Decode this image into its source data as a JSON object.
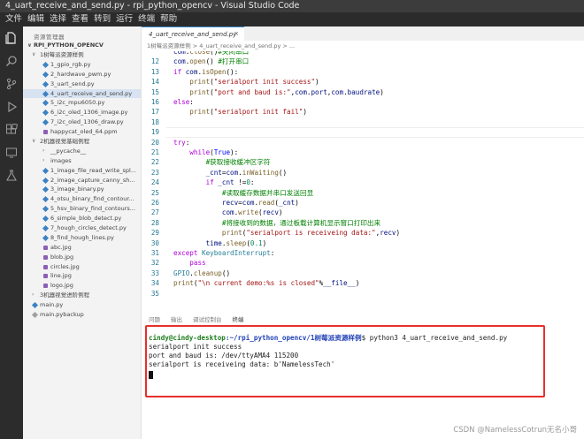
{
  "window": {
    "title": "4_uart_receive_and_send.py - rpi_python_opencv - Visual Studio Code"
  },
  "menu": [
    "文件",
    "编辑",
    "选择",
    "查看",
    "转到",
    "运行",
    "终端",
    "帮助"
  ],
  "activity_icons": [
    "explorer-icon",
    "search-icon",
    "source-control-icon",
    "run-debug-icon",
    "extensions-icon",
    "remote-icon",
    "test-icon"
  ],
  "sidebar": {
    "title": "资源管理器",
    "root": "RPI_PYTHON_OPENCV",
    "items": [
      {
        "label": "1树莓派资源样例",
        "kind": "folder-open",
        "depth": 0
      },
      {
        "label": "1_gpio_rgb.py",
        "kind": "py",
        "depth": 1
      },
      {
        "label": "2_hardwave_pwm.py",
        "kind": "py",
        "depth": 1
      },
      {
        "label": "3_uart_send.py",
        "kind": "py",
        "depth": 1
      },
      {
        "label": "4_uart_receive_and_send.py",
        "kind": "py",
        "depth": 1,
        "selected": true
      },
      {
        "label": "5_i2c_mpu6050.py",
        "kind": "py",
        "depth": 1
      },
      {
        "label": "6_i2c_oled_1306_image.py",
        "kind": "py",
        "depth": 1
      },
      {
        "label": "7_i2c_oled_1306_draw.py",
        "kind": "py",
        "depth": 1
      },
      {
        "label": "happycat_oled_64.ppm",
        "kind": "img",
        "depth": 1
      },
      {
        "label": "2机器视觉基础例程",
        "kind": "folder-open",
        "depth": 0
      },
      {
        "label": "__pycache__",
        "kind": "folder",
        "depth": 1
      },
      {
        "label": "images",
        "kind": "folder",
        "depth": 1
      },
      {
        "label": "1_image_file_read_write_spl...",
        "kind": "py",
        "depth": 1
      },
      {
        "label": "2_image_capture_canny_sh...",
        "kind": "py",
        "depth": 1
      },
      {
        "label": "3_image_binary.py",
        "kind": "py",
        "depth": 1
      },
      {
        "label": "4_otsu_binary_find_contour...",
        "kind": "py",
        "depth": 1
      },
      {
        "label": "5_hsv_binary_find_contours...",
        "kind": "py",
        "depth": 1
      },
      {
        "label": "6_simple_blob_detect.py",
        "kind": "py",
        "depth": 1
      },
      {
        "label": "7_hough_circles_detect.py",
        "kind": "py",
        "depth": 1
      },
      {
        "label": "8_find_hough_lines.py",
        "kind": "py",
        "depth": 1
      },
      {
        "label": "abc.jpg",
        "kind": "img",
        "depth": 1
      },
      {
        "label": "blob.jpg",
        "kind": "img",
        "depth": 1
      },
      {
        "label": "circles.jpg",
        "kind": "img",
        "depth": 1
      },
      {
        "label": "line.jpg",
        "kind": "img",
        "depth": 1
      },
      {
        "label": "logo.jpg",
        "kind": "img",
        "depth": 1
      },
      {
        "label": "3机器视觉进阶例程",
        "kind": "folder",
        "depth": 0
      },
      {
        "label": "main.py",
        "kind": "py",
        "depth": 0
      },
      {
        "label": "main.pybackup",
        "kind": "bak",
        "depth": 0
      }
    ]
  },
  "editor": {
    "tab": {
      "label": "4_uart_receive_and_send.py",
      "close": "×"
    },
    "breadcrumb": "1树莓派资源样例 > 4_uart_receive_and_send.py > ...",
    "lines": [
      {
        "n": "",
        "src": [
          [
            "v",
            "com"
          ],
          [
            "d",
            "."
          ],
          [
            "f",
            "close"
          ],
          [
            "d",
            "()"
          ],
          [
            "c",
            "#关闭串口"
          ]
        ],
        "clip": true
      },
      {
        "n": "12",
        "src": [
          [
            "v",
            "com"
          ],
          [
            "d",
            "."
          ],
          [
            "f",
            "open"
          ],
          [
            "d",
            "() "
          ],
          [
            "c",
            "#打开串口"
          ]
        ]
      },
      {
        "n": "13",
        "src": [
          [
            "k",
            "if "
          ],
          [
            "v",
            "com"
          ],
          [
            "d",
            "."
          ],
          [
            "f",
            "isOpen"
          ],
          [
            "d",
            "():"
          ]
        ]
      },
      {
        "n": "14",
        "src": [
          [
            "d",
            "    "
          ],
          [
            "f",
            "print"
          ],
          [
            "d",
            "("
          ],
          [
            "s",
            "\"serialport init success\""
          ],
          [
            "d",
            ")"
          ]
        ]
      },
      {
        "n": "15",
        "src": [
          [
            "d",
            "    "
          ],
          [
            "f",
            "print"
          ],
          [
            "d",
            "("
          ],
          [
            "s",
            "\"port and baud is:\""
          ],
          [
            "d",
            ","
          ],
          [
            "v",
            "com"
          ],
          [
            "d",
            "."
          ],
          [
            "v",
            "port"
          ],
          [
            "d",
            ","
          ],
          [
            "v",
            "com"
          ],
          [
            "d",
            "."
          ],
          [
            "v",
            "baudrate"
          ],
          [
            "d",
            ")"
          ]
        ]
      },
      {
        "n": "16",
        "src": [
          [
            "k",
            "else"
          ],
          [
            "d",
            ":"
          ]
        ]
      },
      {
        "n": "17",
        "src": [
          [
            "d",
            "    "
          ],
          [
            "f",
            "print"
          ],
          [
            "d",
            "("
          ],
          [
            "s",
            "\"serialport init fail\""
          ],
          [
            "d",
            ")"
          ]
        ]
      },
      {
        "n": "18",
        "src": []
      },
      {
        "n": "19",
        "src": [],
        "current": true
      },
      {
        "n": "20",
        "src": [
          [
            "k",
            "try"
          ],
          [
            "d",
            ":"
          ]
        ]
      },
      {
        "n": "21",
        "src": [
          [
            "d",
            "    "
          ],
          [
            "k",
            "while"
          ],
          [
            "d",
            "("
          ],
          [
            "kb",
            "True"
          ],
          [
            "d",
            "):"
          ]
        ]
      },
      {
        "n": "22",
        "src": [
          [
            "d",
            "        "
          ],
          [
            "c",
            "#获取接收缓冲区字符"
          ]
        ]
      },
      {
        "n": "23",
        "src": [
          [
            "d",
            "        "
          ],
          [
            "v",
            "_cnt"
          ],
          [
            "d",
            "="
          ],
          [
            "v",
            "com"
          ],
          [
            "d",
            "."
          ],
          [
            "f",
            "inWaiting"
          ],
          [
            "d",
            "()"
          ]
        ]
      },
      {
        "n": "24",
        "src": [
          [
            "d",
            "        "
          ],
          [
            "k",
            "if "
          ],
          [
            "v",
            "_cnt"
          ],
          [
            "d",
            " !="
          ],
          [
            "n",
            "0"
          ],
          [
            "d",
            ":"
          ]
        ]
      },
      {
        "n": "25",
        "src": [
          [
            "d",
            "            "
          ],
          [
            "c",
            "#读取缓存数据并串口发送回显"
          ]
        ]
      },
      {
        "n": "26",
        "src": [
          [
            "d",
            "            "
          ],
          [
            "v",
            "recv"
          ],
          [
            "d",
            "="
          ],
          [
            "v",
            "com"
          ],
          [
            "d",
            "."
          ],
          [
            "f",
            "read"
          ],
          [
            "d",
            "("
          ],
          [
            "v",
            "_cnt"
          ],
          [
            "d",
            ")"
          ]
        ]
      },
      {
        "n": "27",
        "src": [
          [
            "d",
            "            "
          ],
          [
            "v",
            "com"
          ],
          [
            "d",
            "."
          ],
          [
            "f",
            "write"
          ],
          [
            "d",
            "("
          ],
          [
            "v",
            "recv"
          ],
          [
            "d",
            ")"
          ]
        ]
      },
      {
        "n": "28",
        "src": [
          [
            "d",
            "            "
          ],
          [
            "c",
            "#将接收到的数据，通过板载计算机显示窗口打印出来"
          ]
        ]
      },
      {
        "n": "29",
        "src": [
          [
            "d",
            "            "
          ],
          [
            "f",
            "print"
          ],
          [
            "d",
            "("
          ],
          [
            "s",
            "\"serialport is receiveing data:\""
          ],
          [
            "d",
            ","
          ],
          [
            "v",
            "recv"
          ],
          [
            "d",
            ")"
          ]
        ]
      },
      {
        "n": "30",
        "src": [
          [
            "d",
            "        "
          ],
          [
            "v",
            "time"
          ],
          [
            "d",
            "."
          ],
          [
            "f",
            "sleep"
          ],
          [
            "d",
            "("
          ],
          [
            "n",
            "0.1"
          ],
          [
            "d",
            ")"
          ]
        ]
      },
      {
        "n": "31",
        "src": [
          [
            "k",
            "except "
          ],
          [
            "t",
            "KeyboardInterrupt"
          ],
          [
            "d",
            ":"
          ]
        ]
      },
      {
        "n": "32",
        "src": [
          [
            "d",
            "    "
          ],
          [
            "k",
            "pass"
          ]
        ]
      },
      {
        "n": "33",
        "src": [
          [
            "t",
            "GPIO"
          ],
          [
            "d",
            "."
          ],
          [
            "f",
            "cleanup"
          ],
          [
            "d",
            "()"
          ]
        ]
      },
      {
        "n": "34",
        "src": [
          [
            "f",
            "print"
          ],
          [
            "d",
            "("
          ],
          [
            "s",
            "\"\\n current demo:%s is closed\""
          ],
          [
            "d",
            "%"
          ],
          [
            "v",
            "__file__"
          ],
          [
            "d",
            ")"
          ]
        ]
      },
      {
        "n": "35",
        "src": []
      }
    ]
  },
  "panel": {
    "tabs": [
      "问题",
      "输出",
      "调试控制台",
      "终端"
    ],
    "active_tab": "终端"
  },
  "terminal": {
    "prompt_user": "cindy@cindy-desktop",
    "prompt_path": ":~/rpi_python_opencv/1树莓派资源样例",
    "command": "$ python3 4_uart_receive_and_send.py",
    "output": [
      "serialport init success",
      "port and baud is: /dev/ttyAMA4 115200",
      "serialport is receiveing data: b'NamelessTech'"
    ]
  },
  "watermark": "CSDN @NamelessCotrun无名小哥",
  "colors": {
    "highlight_border": "#e8302b",
    "accent": "#3c8dcf"
  }
}
